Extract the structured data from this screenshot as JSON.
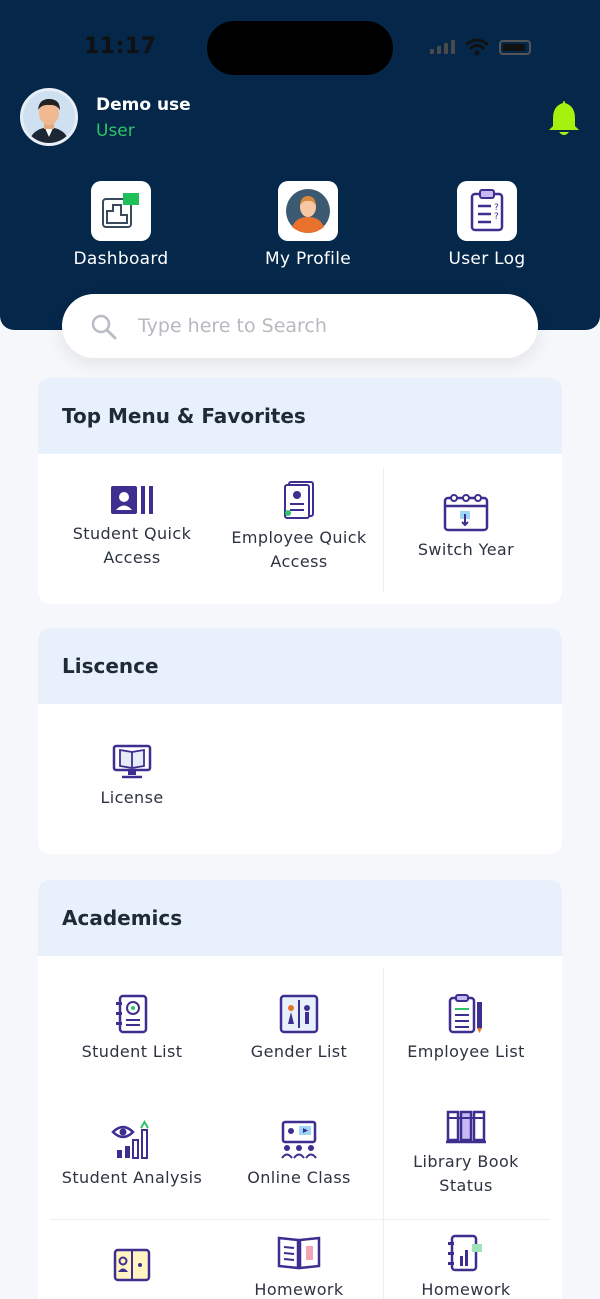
{
  "status_bar": {
    "time": "11:17"
  },
  "user": {
    "name": "Demo use",
    "role": "User"
  },
  "quick_actions": [
    {
      "label": "Dashboard",
      "icon": "dashboard-icon"
    },
    {
      "label": "My Profile",
      "icon": "profile-icon"
    },
    {
      "label": "User Log",
      "icon": "user-log-icon"
    }
  ],
  "search": {
    "placeholder": "Type here to Search"
  },
  "sections": [
    {
      "title": "Top Menu & Favorites",
      "items": [
        "Student Quick Access",
        "Employee Quick Access",
        "Switch Year"
      ]
    },
    {
      "title": "Liscence",
      "items": [
        "License"
      ]
    },
    {
      "title": "Academics",
      "items": [
        "Student List",
        "Gender List",
        "Employee List",
        "Student Analysis",
        "Online Class",
        "Library Book Status",
        "",
        "Homework",
        "Homework"
      ]
    }
  ],
  "colors": {
    "header": "#04274a",
    "accent_green": "#2fc46a",
    "bell": "#a6f20e",
    "icon_purple": "#3d2e8f",
    "section_head": "#e8f0fc"
  }
}
